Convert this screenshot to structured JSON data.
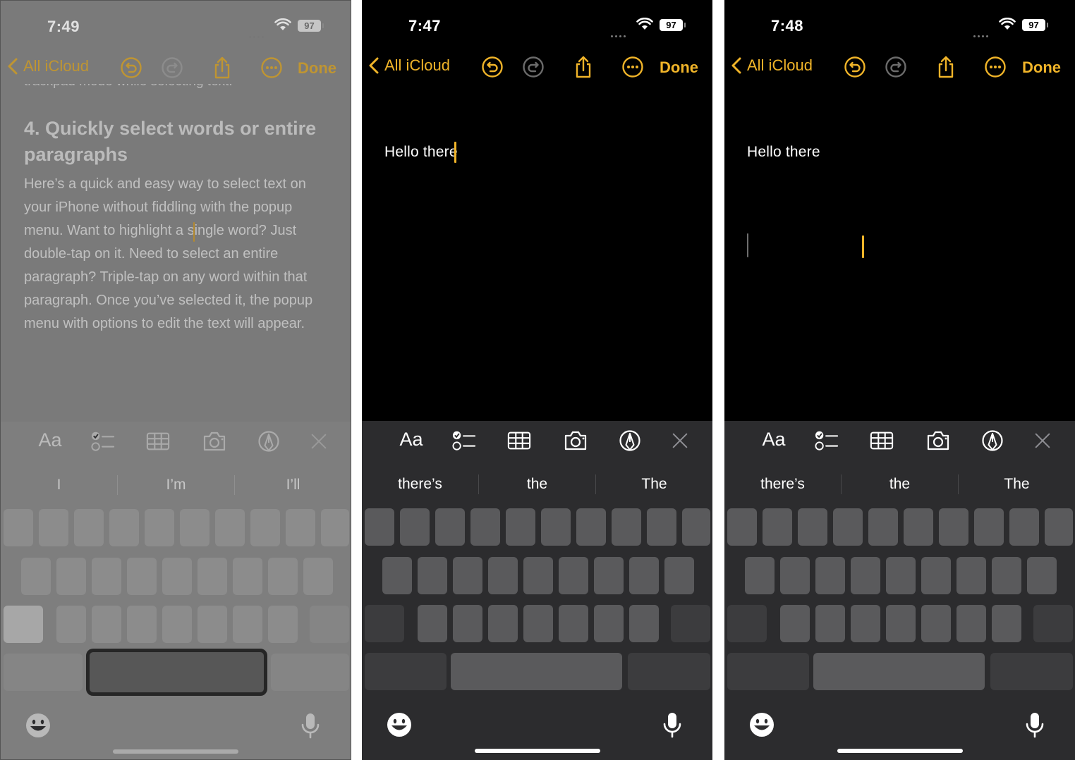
{
  "colors": {
    "accent": "#f0b429",
    "dark_bg": "#000000",
    "keyboard_bg": "#2c2c2e",
    "key": "#5a5a5c",
    "faded_bg": "#7a7a7a"
  },
  "screens": [
    {
      "id": "trackpad-mode",
      "status": {
        "time": "7:49",
        "battery": "97"
      },
      "nav": {
        "back_label": "All iCloud",
        "done_label": "Done"
      },
      "note": {
        "heading": "4. Quickly select words or entire paragraphs",
        "paragraph": "Here’s a quick and easy way to select text on your iPhone without fiddling with the popup menu. Want to highlight a single word? Just double-tap on it. Need to select an entire paragraph? Triple-tap on any word within that paragraph. Once you’ve selected it, the popup menu with options to edit the text will appear."
      },
      "toolbar": {
        "format_label": "Aa"
      },
      "suggestions": [
        "I",
        "I’m",
        "I’ll"
      ]
    },
    {
      "id": "cursor-at-text",
      "status": {
        "time": "7:47",
        "battery": "97"
      },
      "nav": {
        "back_label": "All iCloud",
        "done_label": "Done"
      },
      "note": {
        "text": "Hello there"
      },
      "toolbar": {
        "format_label": "Aa"
      },
      "suggestions": [
        "there’s",
        "the",
        "The"
      ]
    },
    {
      "id": "cursor-moved",
      "status": {
        "time": "7:48",
        "battery": "97"
      },
      "nav": {
        "back_label": "All iCloud",
        "done_label": "Done"
      },
      "note": {
        "text": "Hello there"
      },
      "toolbar": {
        "format_label": "Aa"
      },
      "suggestions": [
        "there’s",
        "the",
        "The"
      ]
    }
  ],
  "icons": [
    "chevron-left-icon",
    "undo-icon",
    "redo-icon",
    "share-icon",
    "more-icon",
    "checklist-icon",
    "table-icon",
    "camera-icon",
    "markup-icon",
    "close-icon",
    "emoji-icon",
    "microphone-icon",
    "wifi-icon"
  ]
}
